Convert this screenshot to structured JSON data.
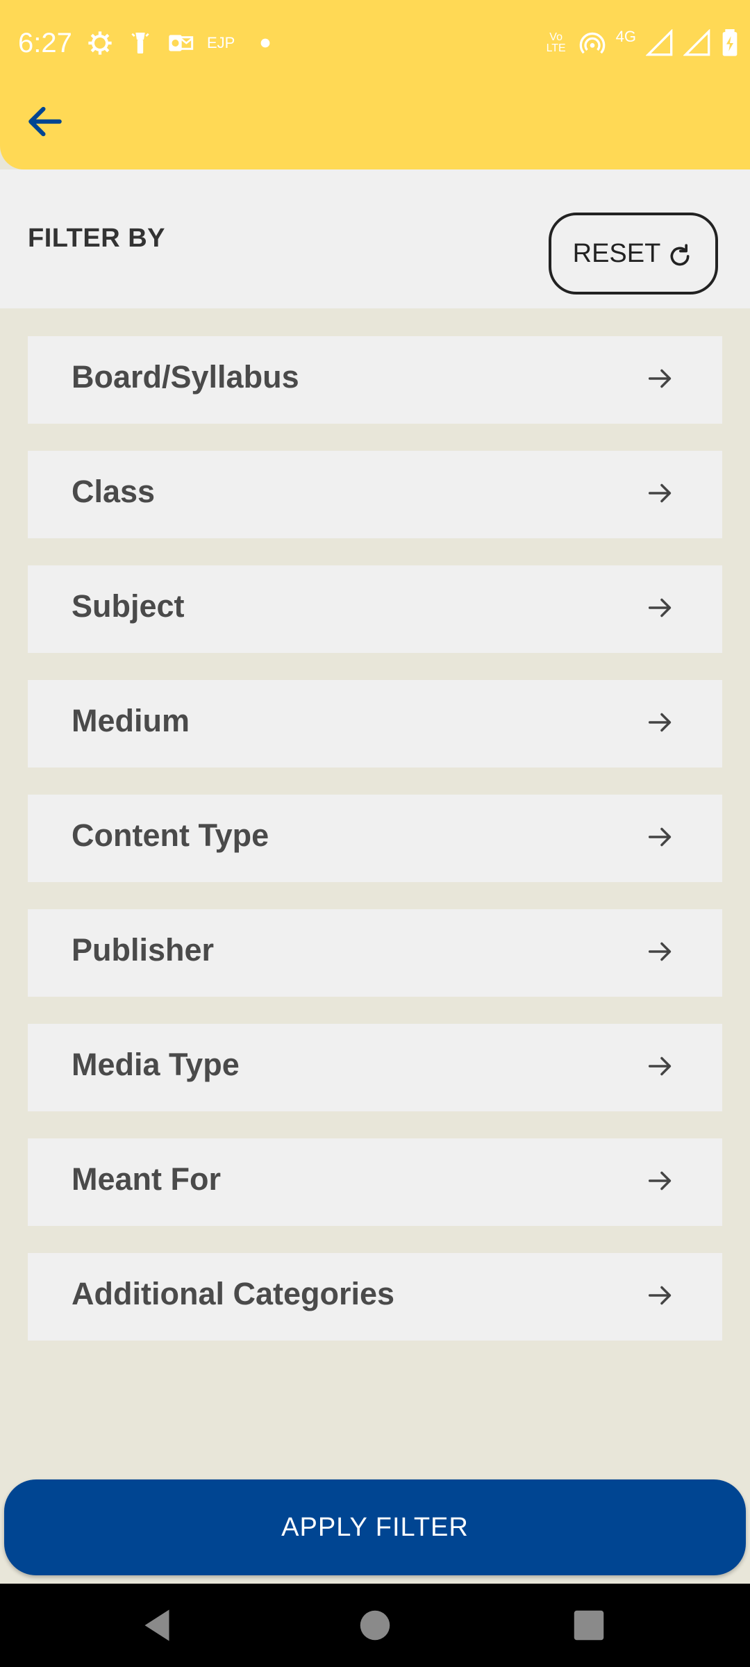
{
  "status_bar": {
    "time": "6:27",
    "left_text": "EJP",
    "network": "4G",
    "volte": "Vo LTE"
  },
  "header": {
    "back_icon": "arrow-left-icon",
    "accent_color": "#FFD955",
    "back_color": "#004592"
  },
  "filter": {
    "title": "FILTER BY",
    "reset_label": "RESET",
    "reset_icon": "refresh-icon",
    "items": [
      {
        "label": "Board/Syllabus",
        "icon": "arrow-right-icon"
      },
      {
        "label": "Class",
        "icon": "arrow-right-icon"
      },
      {
        "label": "Subject",
        "icon": "arrow-right-icon"
      },
      {
        "label": "Medium",
        "icon": "arrow-right-icon"
      },
      {
        "label": "Content Type",
        "icon": "arrow-right-icon"
      },
      {
        "label": "Publisher",
        "icon": "arrow-right-icon"
      },
      {
        "label": "Media Type",
        "icon": "arrow-right-icon"
      },
      {
        "label": "Meant For",
        "icon": "arrow-right-icon"
      },
      {
        "label": "Additional Categories",
        "icon": "arrow-right-icon"
      }
    ]
  },
  "apply": {
    "label": "APPLY FILTER",
    "color": "#004592"
  }
}
